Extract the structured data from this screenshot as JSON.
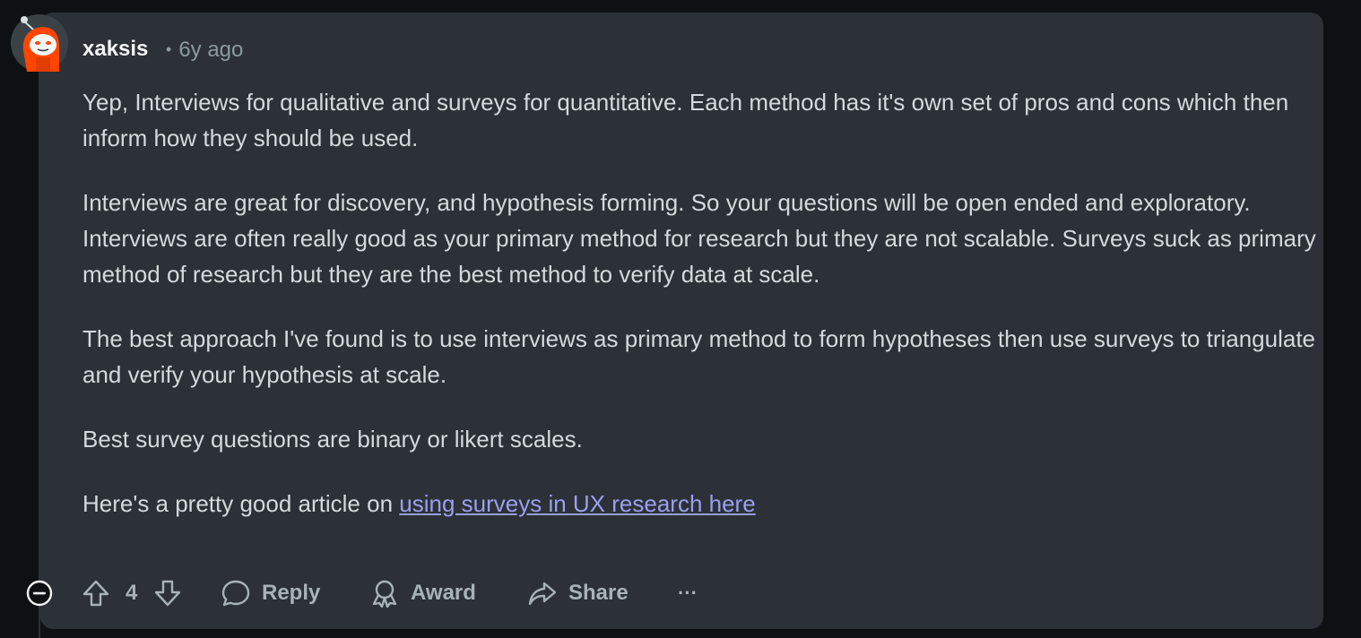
{
  "comment": {
    "author": "xaksis",
    "separator": "•",
    "age": "6y ago",
    "paragraphs": [
      "Yep, Interviews for qualitative and surveys for quantitative. Each method has it's own set of pros and cons which then inform how they should be used.",
      "Interviews are great for discovery, and hypothesis forming. So your questions will be open ended and exploratory. Interviews are often really good as your primary method for research but they are not scalable. Surveys suck as primary method of research but they are the best method to verify data at scale.",
      "The best approach I've found is to use interviews as primary method to form hypotheses then use surveys to triangulate and verify your hypothesis at scale.",
      "Best survey questions are binary or likert scales."
    ],
    "link_intro": "Here's a pretty good article on ",
    "link_text": "using surveys in UX research here"
  },
  "actions": {
    "vote_count": "4",
    "reply_label": "Reply",
    "award_label": "Award",
    "share_label": "Share",
    "more_label": "···"
  },
  "icons": {
    "collapse": "collapse-minus-circle-icon",
    "upvote": "upvote-arrow-icon",
    "downvote": "downvote-arrow-icon",
    "reply": "speech-bubble-icon",
    "award": "award-ribbon-icon",
    "share": "share-arrow-icon",
    "more": "ellipsis-icon"
  },
  "colors": {
    "background": "#0e1113",
    "card": "#2b3136",
    "text": "#d4d9dc",
    "link": "#9c9ff0",
    "muted": "#8c9a9f",
    "avatar_accent": "#ff4500"
  }
}
